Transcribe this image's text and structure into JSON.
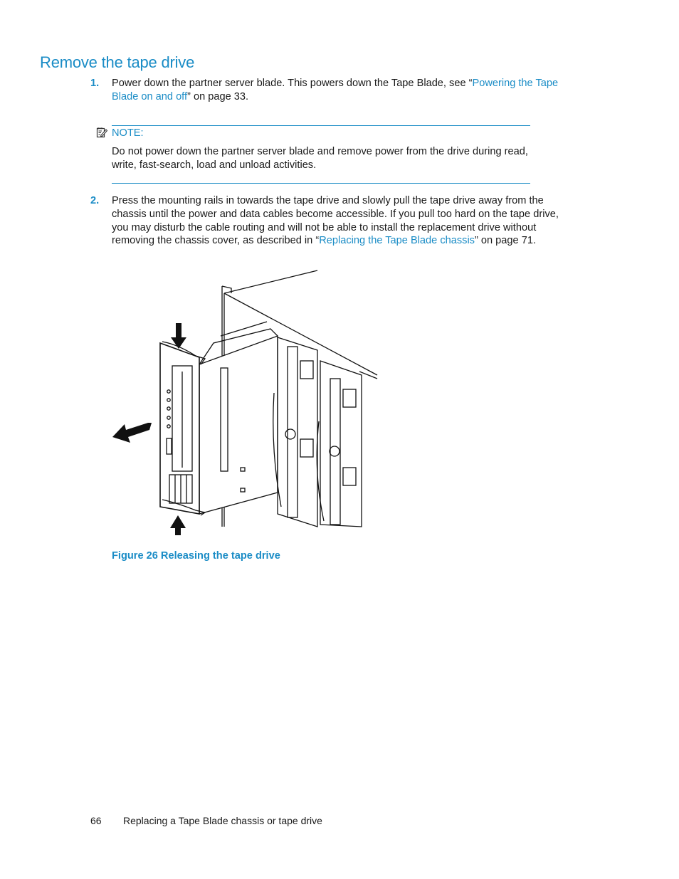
{
  "heading": "Remove the tape drive",
  "steps": [
    {
      "number": "1.",
      "text_before": "Power down the partner server blade. This powers down the Tape Blade, see “",
      "link": "Powering the Tape Blade on and off",
      "text_after": "” on page 33."
    },
    {
      "number": "2.",
      "text_before": "Press the mounting rails in towards the tape drive and slowly pull the tape drive away from the chassis until the power and data cables become accessible. If you pull too hard on the tape drive, you may disturb the cable routing and will not be able to install the replacement drive without removing the chassis cover, as described in “",
      "link": "Replacing the Tape Blade chassis",
      "text_after": "” on page 71."
    }
  ],
  "note": {
    "icon": "note-pencil-icon",
    "title": "NOTE:",
    "body": "Do not power down the partner server blade and remove power from the drive during read, write, fast-search, load and unload activities."
  },
  "figure": {
    "caption": "Figure 26 Releasing the tape drive",
    "description": "Line drawing of a tape drive being pulled out of a blade chassis, with arrows pressing the mounting rails and pulling the drive away"
  },
  "footer": {
    "page_number": "66",
    "chapter": "Replacing a Tape Blade chassis or tape drive"
  },
  "colors": {
    "accent": "#1a8cc6",
    "text": "#1a1a1a"
  }
}
